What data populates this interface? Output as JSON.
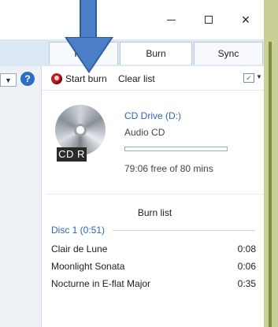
{
  "window": {
    "minimize_glyph": "–",
    "maximize_glyph": "□",
    "close_glyph": "×"
  },
  "tabs": [
    {
      "label": "Play"
    },
    {
      "label": "Burn"
    },
    {
      "label": "Sync"
    }
  ],
  "toolbar": {
    "start_burn_label": "Start burn",
    "clear_list_label": "Clear list",
    "options_icon": "list-options-icon"
  },
  "drive": {
    "name": "CD Drive (D:)",
    "type": "Audio CD",
    "disc_label": "CD R",
    "free_space": "79:06 free of 80 mins",
    "usage_fraction": 0.0
  },
  "burn_list": {
    "title": "Burn list",
    "disc_header": "Disc 1 (0:51)",
    "tracks": [
      {
        "title": "Clair de Lune",
        "duration": "0:08"
      },
      {
        "title": "Moonlight Sonata",
        "duration": "0:06"
      },
      {
        "title": "Nocturne in E-flat Major",
        "duration": "0:35"
      }
    ]
  },
  "colors": {
    "accent": "#2f64b5",
    "annotation_arrow": "#4a7fc8"
  }
}
